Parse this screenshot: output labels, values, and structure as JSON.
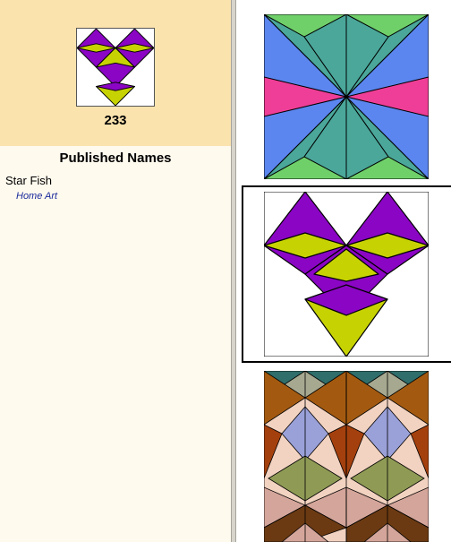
{
  "block": {
    "number": "233",
    "names_heading": "Published Names",
    "published_names": [
      {
        "name": "Star Fish",
        "source": "Home Art"
      }
    ]
  },
  "colors": {
    "left_background": "#fffaee",
    "thumb_panel": "#fbe3ae",
    "purple": "#8b05c4",
    "yellow": "#c7d203",
    "source_text": "#1a2a9c",
    "selection_border": "#000000"
  },
  "variants": [
    {
      "label": "variant-1",
      "palette": [
        "#5b86ef",
        "#4aa79a",
        "#6fd06a",
        "#ef3e97"
      ]
    },
    {
      "label": "variant-2",
      "palette": [
        "#8b05c4",
        "#c7d203",
        "#ffffff"
      ],
      "selected": true
    },
    {
      "label": "variant-3",
      "palette": [
        "#2f6e6b",
        "#a35a10",
        "#f2d2c0",
        "#9aa0d8",
        "#8f9a55",
        "#d4a59a",
        "#6b3a12"
      ]
    }
  ]
}
